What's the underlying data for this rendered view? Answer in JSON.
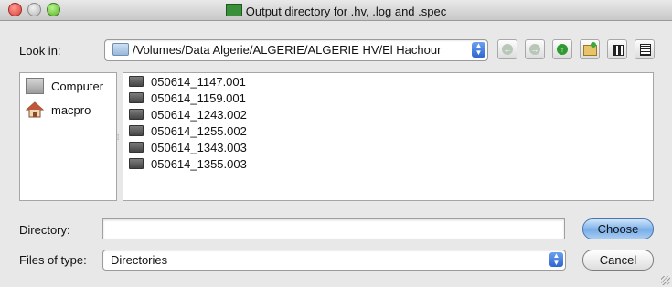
{
  "window": {
    "title": "Output directory for .hv, .log and .spec"
  },
  "look_in": {
    "label": "Look in:",
    "path": "/Volumes/Data Algerie/ALGERIE/ALGERIE HV/El Hachour"
  },
  "toolbar": {
    "buttons": [
      "back-icon",
      "forward-icon",
      "up-icon",
      "new-folder-icon",
      "list-view-icon",
      "detail-view-icon"
    ]
  },
  "sidebar": {
    "items": [
      {
        "label": "Computer",
        "icon": "computer-icon"
      },
      {
        "label": "macpro",
        "icon": "home-icon"
      }
    ]
  },
  "files": [
    "050614_1147.001",
    "050614_1159.001",
    "050614_1243.002",
    "050614_1255.002",
    "050614_1343.003",
    "050614_1355.003"
  ],
  "directory": {
    "label": "Directory:",
    "value": ""
  },
  "file_type": {
    "label": "Files of type:",
    "value": "Directories"
  },
  "buttons": {
    "choose": "Choose",
    "cancel": "Cancel"
  }
}
